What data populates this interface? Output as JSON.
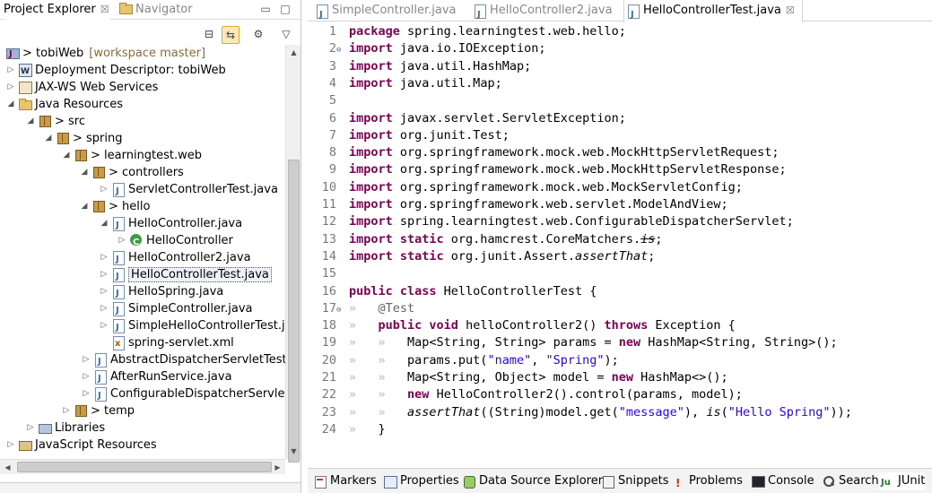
{
  "explorer": {
    "tabs": [
      {
        "label": "Project Explorer",
        "close": "☒"
      },
      {
        "label": "Navigator"
      }
    ],
    "tree": [
      {
        "label": "> tobiWeb",
        "extra": "[workspace master]",
        "icon": "project-icon",
        "arrow": "▾"
      },
      {
        "label": "Deployment Descriptor: tobiWeb",
        "icon": "descriptor-icon",
        "arrow": "▷"
      },
      {
        "label": "JAX-WS Web Services",
        "icon": "webservice-icon",
        "arrow": "▷"
      },
      {
        "label": "Java Resources",
        "icon": "java-resources-icon",
        "arrow": "◢"
      },
      {
        "label": "> src",
        "icon": "source-folder-icon",
        "arrow": "◢"
      },
      {
        "label": "> spring",
        "icon": "package-icon",
        "arrow": "◢"
      },
      {
        "label": "> learningtest.web",
        "icon": "package-icon",
        "arrow": "◢"
      },
      {
        "label": "> controllers",
        "icon": "package-icon",
        "arrow": "◢"
      },
      {
        "label": "ServletControllerTest.java",
        "icon": "java-file-icon",
        "arrow": "▷"
      },
      {
        "label": "> hello",
        "icon": "package-icon",
        "arrow": "◢"
      },
      {
        "label": "HelloController.java",
        "icon": "java-file-icon",
        "arrow": "◢"
      },
      {
        "label": "HelloController",
        "icon": "class-icon",
        "arrow": "▷"
      },
      {
        "label": "HelloController2.java",
        "icon": "java-file-icon",
        "arrow": "▷"
      },
      {
        "label": "HelloControllerTest.java",
        "icon": "java-file-icon",
        "arrow": "▷"
      },
      {
        "label": "HelloSpring.java",
        "icon": "java-file-icon",
        "arrow": "▷"
      },
      {
        "label": "SimpleController.java",
        "icon": "java-file-icon",
        "arrow": "▷"
      },
      {
        "label": "SimpleHelloControllerTest.jav",
        "icon": "java-file-icon",
        "arrow": "▷"
      },
      {
        "label": "spring-servlet.xml",
        "icon": "xml-file-icon",
        "arrow": ""
      },
      {
        "label": "AbstractDispatcherServletTest.jav",
        "icon": "java-file-icon",
        "arrow": "▷"
      },
      {
        "label": "AfterRunService.java",
        "icon": "java-file-icon",
        "arrow": "▷"
      },
      {
        "label": "ConfigurableDispatcherServlet.ja",
        "icon": "java-file-icon",
        "arrow": "▷"
      },
      {
        "label": "> temp",
        "icon": "package-icon",
        "arrow": "▷"
      },
      {
        "label": "Libraries",
        "icon": "library-icon",
        "arrow": "▷"
      },
      {
        "label": "JavaScript Resources",
        "icon": "javascript-resources-icon",
        "arrow": "▷"
      }
    ]
  },
  "editor": {
    "tabs": [
      {
        "label": "SimpleController.java"
      },
      {
        "label": "HelloController2.java"
      },
      {
        "label": "HelloControllerTest.java",
        "close": "☒"
      }
    ]
  },
  "bottom_tabs": [
    {
      "label": "Markers",
      "icon": "markers-icon"
    },
    {
      "label": "Properties",
      "icon": "properties-icon"
    },
    {
      "label": "Data Source Explorer",
      "icon": "data-source-icon"
    },
    {
      "label": "Snippets",
      "icon": "snippets-icon"
    },
    {
      "label": "Problems",
      "icon": "problems-icon"
    },
    {
      "label": "Console",
      "icon": "console-icon"
    },
    {
      "label": "Search",
      "icon": "search-icon"
    },
    {
      "label": "JUnit",
      "icon": "junit-icon"
    }
  ],
  "colors": {
    "keyword": "#7f0055",
    "string": "#2a00ff",
    "annotation": "#646464"
  }
}
